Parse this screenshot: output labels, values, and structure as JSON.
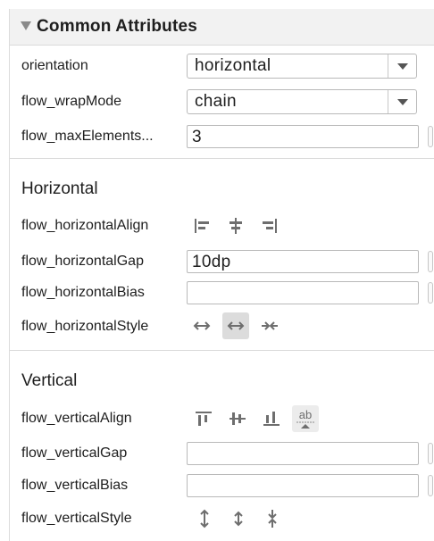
{
  "header": {
    "title": "Common Attributes"
  },
  "rows": {
    "orientation": {
      "label": "orientation",
      "value": "horizontal"
    },
    "wrap_mode": {
      "label": "flow_wrapMode",
      "value": "chain"
    },
    "max_elements": {
      "label": "flow_maxElements...",
      "value": "3"
    }
  },
  "horizontal": {
    "title": "Horizontal",
    "align_label": "flow_horizontalAlign",
    "gap_label": "flow_horizontalGap",
    "gap_value": "10dp",
    "bias_label": "flow_horizontalBias",
    "bias_value": "",
    "style_label": "flow_horizontalStyle",
    "align_icons": [
      "align-left-icon",
      "align-center-horizontal-icon",
      "align-right-icon"
    ],
    "style_icons": [
      "spread-icon",
      "spread-inside-icon",
      "packed-icon"
    ],
    "style_selected": "spread-inside-icon"
  },
  "vertical": {
    "title": "Vertical",
    "align_label": "flow_verticalAlign",
    "gap_label": "flow_verticalGap",
    "gap_value": "",
    "bias_label": "flow_verticalBias",
    "bias_value": "",
    "style_label": "flow_verticalStyle",
    "align_icons": [
      "align-top-icon",
      "align-center-vertical-icon",
      "align-bottom-icon",
      "align-baseline-icon"
    ],
    "baseline_icon_text": "ab",
    "style_icons": [
      "spread-vertical-icon",
      "spread-inside-vertical-icon",
      "packed-vertical-icon"
    ]
  },
  "colors": {
    "icon": "#6e6e6e",
    "selected_bg": "#dcdcdc",
    "header_bg": "#f2f2f2"
  }
}
